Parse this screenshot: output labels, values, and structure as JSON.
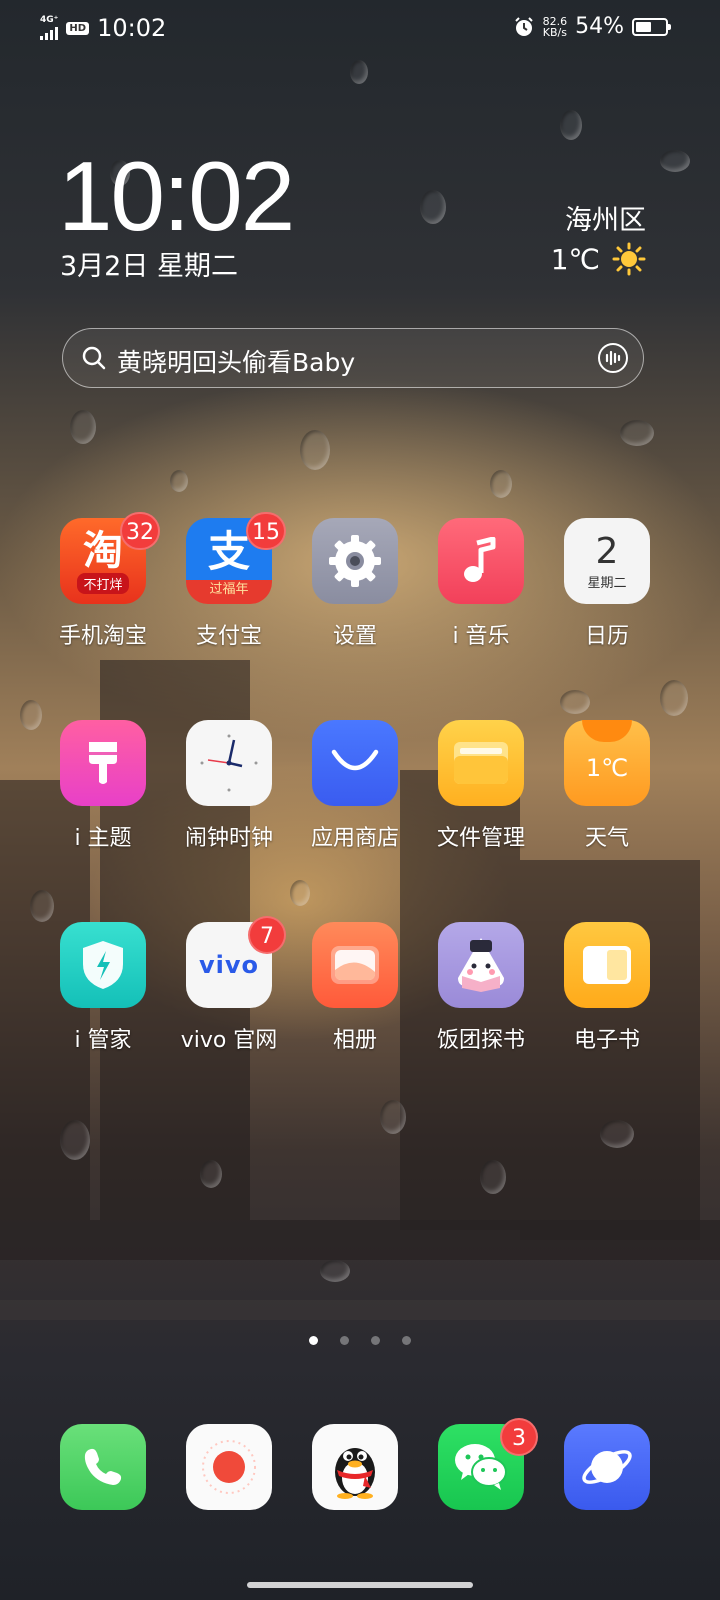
{
  "status_bar": {
    "network": "4G⁺",
    "hd": "HD",
    "time": "10:02",
    "speed_value": "82.6",
    "speed_unit": "KB/s",
    "battery": "54%",
    "battery_level": 0.54
  },
  "clock": {
    "time": "10:02",
    "date": "3月2日 星期二"
  },
  "weather": {
    "location": "海州区",
    "temp": "1℃",
    "condition_icon": "sun-icon"
  },
  "search": {
    "query": "黄晓明回头偷看Baby"
  },
  "apps": [
    {
      "label": "手机淘宝",
      "badge": "32",
      "icon_text": "淘",
      "icon_sub": "不打烊"
    },
    {
      "label": "支付宝",
      "badge": "15",
      "icon_text": "支",
      "icon_sub": "过福年"
    },
    {
      "label": "设置",
      "badge": ""
    },
    {
      "label": "i 音乐",
      "badge": ""
    },
    {
      "label": "日历",
      "badge": "",
      "icon_text": "2",
      "icon_sub": "星期二"
    },
    {
      "label": "i 主题",
      "badge": ""
    },
    {
      "label": "闹钟时钟",
      "badge": ""
    },
    {
      "label": "应用商店",
      "badge": ""
    },
    {
      "label": "文件管理",
      "badge": ""
    },
    {
      "label": "天气",
      "badge": "",
      "icon_text": "1℃"
    },
    {
      "label": "i 管家",
      "badge": ""
    },
    {
      "label": "vivo 官网",
      "badge": "7",
      "icon_text": "vivo"
    },
    {
      "label": "相册",
      "badge": ""
    },
    {
      "label": "饭团探书",
      "badge": ""
    },
    {
      "label": "电子书",
      "badge": ""
    }
  ],
  "dock": [
    {
      "name": "phone",
      "badge": ""
    },
    {
      "name": "recorder",
      "badge": ""
    },
    {
      "name": "qq",
      "badge": ""
    },
    {
      "name": "wechat",
      "badge": "3"
    },
    {
      "name": "browser",
      "badge": ""
    }
  ],
  "pages": {
    "count": 4,
    "active": 1
  }
}
